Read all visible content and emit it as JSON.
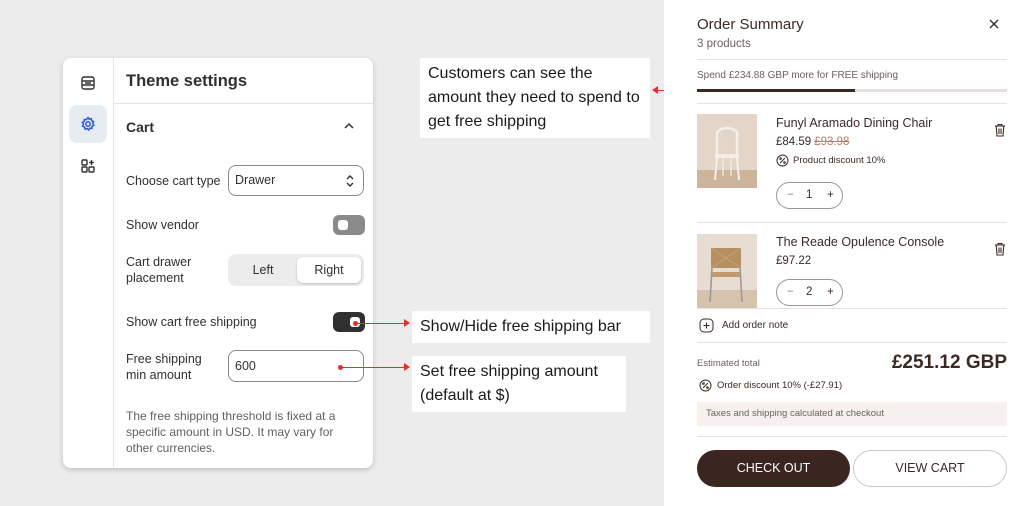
{
  "settings": {
    "title": "Theme settings",
    "section": "Cart",
    "rail_icons": [
      "sections-icon",
      "gear-icon",
      "apps-icon"
    ],
    "cart_type_label": "Choose cart type",
    "cart_type_value": "Drawer",
    "show_vendor_label": "Show vendor",
    "show_vendor_on": false,
    "placement_label_1": "Cart drawer",
    "placement_label_2": "placement",
    "placement_left": "Left",
    "placement_right": "Right",
    "placement_selected": "Right",
    "free_shipping_label": "Show cart free shipping",
    "free_shipping_on": true,
    "min_amount_label_1": "Free shipping",
    "min_amount_label_2": "min amount",
    "min_amount_value": "600",
    "help_text": "The free shipping threshold is fixed at a specific amount in USD. It may vary for other currencies."
  },
  "callouts": {
    "shipping_need": "Customers can see the amount they need to spend to get free shipping",
    "toggle_bar": "Show/Hide free shipping bar",
    "set_amount": "Set free shipping amount (default at $)"
  },
  "drawer": {
    "title": "Order Summary",
    "count": "3 products",
    "shipping_message": "Spend £234.88 GBP more for FREE shipping",
    "shipping_progress": 0.51,
    "items": [
      {
        "name": "Funyl Aramado Dining Chair",
        "price": "£84.59",
        "old_price": "£93.98",
        "discount": "Product discount 10%",
        "qty": "1",
        "minus": "−",
        "plus": "+"
      },
      {
        "name": "The Reade Opulence Console",
        "price": "£97.22",
        "qty": "2",
        "minus": "−",
        "plus": "+"
      }
    ],
    "add_note": "Add order note",
    "est_label": "Estimated total",
    "est_total": "£251.12 GBP",
    "order_discount": "Order discount 10% (-£27.91)",
    "tax_note": "Taxes and shipping calculated at checkout",
    "checkout": "CHECK OUT",
    "view_cart": "VIEW CART"
  },
  "colors": {
    "accent": "#3a2520",
    "arrow": "#e0302f",
    "toggle_on": "#303030",
    "toggle_off": "#8a8a8a"
  }
}
